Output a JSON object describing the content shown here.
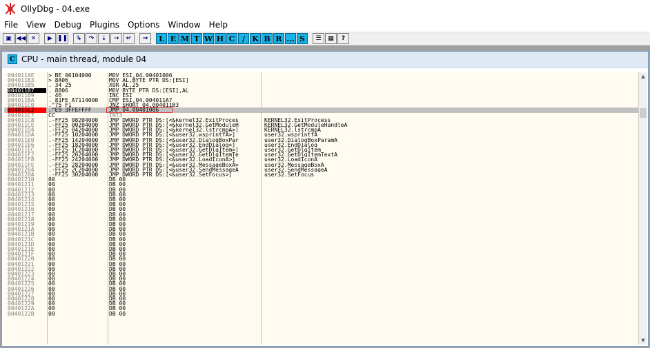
{
  "window": {
    "title": "OllyDbg - 04.exe"
  },
  "menu": [
    "File",
    "View",
    "Debug",
    "Plugins",
    "Options",
    "Window",
    "Help"
  ],
  "toolbar": {
    "buttons": [
      "open-icon",
      "restart-icon",
      "close-icon",
      "run-icon",
      "pause-icon",
      "step-into-icon",
      "step-over-icon",
      "trace-into-icon",
      "trace-over-icon",
      "execute-till-return-icon",
      "go-to-address-icon"
    ],
    "letters": [
      "L",
      "E",
      "M",
      "T",
      "W",
      "H",
      "C",
      "/",
      "K",
      "B",
      "R",
      "...",
      "S"
    ],
    "extras": [
      "list-icon",
      "grid-icon",
      "help-icon"
    ]
  },
  "cpu_window": {
    "title": "CPU - main thread, module 04"
  },
  "rows": [
    {
      "addr": "004011AE",
      "hex": "> BE 06104000",
      "dis": "MOV ESI,04.00401006",
      "com": ""
    },
    {
      "addr": "004011B3",
      "hex": "> 8A06",
      "dis": "MOV AL,BYTE PTR DS:[ESI]",
      "com": ""
    },
    {
      "addr": "004011B5",
      "hex": ". 34 25",
      "dis": "XOR AL,25",
      "com": ""
    },
    {
      "addr": "004011B7",
      "hex": ". 8806",
      "dis": "MOV BYTE PTR DS:[ESI],AL",
      "com": ""
    },
    {
      "addr": "004011B9",
      "hex": ". 46",
      "dis": "INC ESI",
      "com": ""
    },
    {
      "addr": "004011BA",
      "hex": ". 81FE A7114000",
      "dis": "CMP ESI,04.004011A7",
      "com": ""
    },
    {
      "addr": "004011C0",
      "hex": ".^75 F1",
      "dis": "JNZ SHORT 04.004011B3",
      "com": ""
    },
    {
      "addr": "004011C2",
      "hex": ".^E9 3FFEFFFF",
      "dis": "JMP 04.00401006",
      "com": ""
    },
    {
      "addr": "004011C7",
      "hex": "CC",
      "dis": "INT3",
      "com": ""
    },
    {
      "addr": "004011C8",
      "hex": ".-FF25 08204000",
      "dis": "JMP DWORD PTR DS:[<&kernel32.ExitProces",
      "com": "KERNEL32.ExitProcess"
    },
    {
      "addr": "004011CE",
      "hex": ".-FF25 00204000",
      "dis": "JMP DWORD PTR DS:[<&kernel32.GetModuleH",
      "com": "KERNEL32.GetModuleHandleA"
    },
    {
      "addr": "004011D4",
      "hex": ".-FF25 04204000",
      "dis": "JMP DWORD PTR DS:[<&kernel32.lstrcmpA>]",
      "com": "KERNEL32.lstrcmpA"
    },
    {
      "addr": "004011DA",
      "hex": ".-FF25 10204000",
      "dis": "JMP DWORD PTR DS:[<&user32.wsprintfA>]",
      "com": "user32.wsprintfA"
    },
    {
      "addr": "004011E0",
      "hex": ".-FF25 14204000",
      "dis": "JMP DWORD PTR DS:[<&user32.DialogBoxPar",
      "com": "user32.DialogBoxParamA"
    },
    {
      "addr": "004011E6",
      "hex": ".-FF25 18204000",
      "dis": "JMP DWORD PTR DS:[<&user32.EndDialog>]",
      "com": "user32.EndDialog"
    },
    {
      "addr": "004011EC",
      "hex": ".-FF25 1C204000",
      "dis": "JMP DWORD PTR DS:[<&user32.GetDlgItem>]",
      "com": "user32.GetDlgItem"
    },
    {
      "addr": "004011F2",
      "hex": ".-FF25 20204000",
      "dis": "JMP DWORD PTR DS:[<&user32.GetDlgItemTe",
      "com": "user32.GetDlgItemTextA"
    },
    {
      "addr": "004011F8",
      "hex": ".-FF25 24204000",
      "dis": "JMP DWORD PTR DS:[<&user32.LoadIconA>]",
      "com": "user32.LoadIconA"
    },
    {
      "addr": "004011FE",
      "hex": ".-FF25 28204000",
      "dis": "JMP DWORD PTR DS:[<&user32.MessageBoxA>",
      "com": "user32.MessageBoxA"
    },
    {
      "addr": "00401204",
      "hex": ".-FF25 2C204000",
      "dis": "JMP DWORD PTR DS:[<&user32.SendMessageA",
      "com": "user32.SendMessageA"
    },
    {
      "addr": "0040120A",
      "hex": ".-FF25 30204000",
      "dis": "JMP DWORD PTR DS:[<&user32.SetFocus>]",
      "com": "user32.SetFocus"
    },
    {
      "addr": "00401210",
      "hex": "00",
      "dis": "DB 00",
      "com": ""
    },
    {
      "addr": "00401211",
      "hex": "00",
      "dis": "DB 00",
      "com": ""
    },
    {
      "addr": "00401212",
      "hex": "00",
      "dis": "DB 00",
      "com": ""
    },
    {
      "addr": "00401213",
      "hex": "00",
      "dis": "DB 00",
      "com": ""
    },
    {
      "addr": "00401214",
      "hex": "00",
      "dis": "DB 00",
      "com": ""
    },
    {
      "addr": "00401215",
      "hex": "00",
      "dis": "DB 00",
      "com": ""
    },
    {
      "addr": "00401216",
      "hex": "00",
      "dis": "DB 00",
      "com": ""
    },
    {
      "addr": "00401217",
      "hex": "00",
      "dis": "DB 00",
      "com": ""
    },
    {
      "addr": "00401218",
      "hex": "00",
      "dis": "DB 00",
      "com": ""
    },
    {
      "addr": "00401219",
      "hex": "00",
      "dis": "DB 00",
      "com": ""
    },
    {
      "addr": "0040121A",
      "hex": "00",
      "dis": "DB 00",
      "com": ""
    },
    {
      "addr": "0040121B",
      "hex": "00",
      "dis": "DB 00",
      "com": ""
    },
    {
      "addr": "0040121C",
      "hex": "00",
      "dis": "DB 00",
      "com": ""
    },
    {
      "addr": "0040121D",
      "hex": "00",
      "dis": "DB 00",
      "com": ""
    },
    {
      "addr": "0040121E",
      "hex": "00",
      "dis": "DB 00",
      "com": ""
    },
    {
      "addr": "0040121F",
      "hex": "00",
      "dis": "DB 00",
      "com": ""
    },
    {
      "addr": "00401220",
      "hex": "00",
      "dis": "DB 00",
      "com": ""
    },
    {
      "addr": "00401221",
      "hex": "00",
      "dis": "DB 00",
      "com": ""
    },
    {
      "addr": "00401222",
      "hex": "00",
      "dis": "DB 00",
      "com": ""
    },
    {
      "addr": "00401223",
      "hex": "00",
      "dis": "DB 00",
      "com": ""
    },
    {
      "addr": "00401224",
      "hex": "00",
      "dis": "DB 00",
      "com": ""
    },
    {
      "addr": "00401225",
      "hex": "00",
      "dis": "DB 00",
      "com": ""
    },
    {
      "addr": "00401226",
      "hex": "00",
      "dis": "DB 00",
      "com": ""
    },
    {
      "addr": "00401227",
      "hex": "00",
      "dis": "DB 00",
      "com": ""
    },
    {
      "addr": "00401228",
      "hex": "00",
      "dis": "DB 00",
      "com": ""
    },
    {
      "addr": "00401229",
      "hex": "00",
      "dis": "DB 00",
      "com": ""
    },
    {
      "addr": "0040122A",
      "hex": "00",
      "dis": "DB 00",
      "com": ""
    },
    {
      "addr": "0040122B",
      "hex": "00",
      "dis": "DB 00",
      "com": ""
    }
  ],
  "highlights": {
    "eip_row": 3,
    "selected_row": 7,
    "breakpoint_row": 7,
    "boxed_row": 7,
    "gray_row": 8
  },
  "colors": {
    "breakpoint": "#ff0000",
    "eip": "#000000",
    "selection": "#c0c0c0",
    "box": "#e8302e",
    "letter_buttons": "#18b4e8"
  }
}
